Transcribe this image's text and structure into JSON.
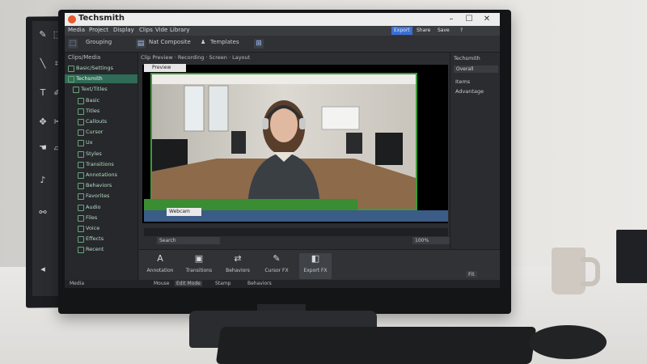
{
  "app": {
    "title": "Techsmith",
    "window_controls": [
      "–",
      "☐",
      "✕"
    ]
  },
  "menu": {
    "items": [
      "Media",
      "Project",
      "Display",
      "Clips",
      "Vide",
      "Library"
    ],
    "right_buttons": [
      "Export",
      "Share",
      "Save",
      "?"
    ]
  },
  "toolbar": {
    "items": [
      "Grouping",
      "Nat Composite",
      "Templates"
    ]
  },
  "left_panel": {
    "header": "Clips/Media",
    "tree": [
      "Basic/Settings",
      "Techsmith",
      "Text/Titles",
      "Basic",
      "Titles",
      "Callouts",
      "Cursor",
      "Ux",
      "Styles",
      "Transitions",
      "Annotations",
      "Behaviors",
      "Favorites",
      "Audio",
      "Files",
      "Voice",
      "Effects",
      "Recent"
    ]
  },
  "preview": {
    "header": "Clip Preview · Recording · Screen · Layout",
    "tab_label": "Preview",
    "label_tag": "Webcam",
    "scrub_field": "Search",
    "scrub_right": "100%"
  },
  "right_panel": {
    "title": "Techsmith",
    "dropdown": "Overall",
    "items": [
      "Items",
      "Advantage"
    ]
  },
  "effects": [
    {
      "icon": "A",
      "label": "Annotation"
    },
    {
      "icon": "▣",
      "label": "Transitions"
    },
    {
      "icon": "⇄",
      "label": "Behaviors"
    },
    {
      "icon": "✎",
      "label": "Cursor FX"
    },
    {
      "icon": "◧",
      "label": "Export FX"
    }
  ],
  "status": {
    "left": "Media",
    "items": [
      "Mouse",
      "Edit Mode",
      "Stamp",
      "Behaviors"
    ],
    "right_badge": "Fit"
  }
}
